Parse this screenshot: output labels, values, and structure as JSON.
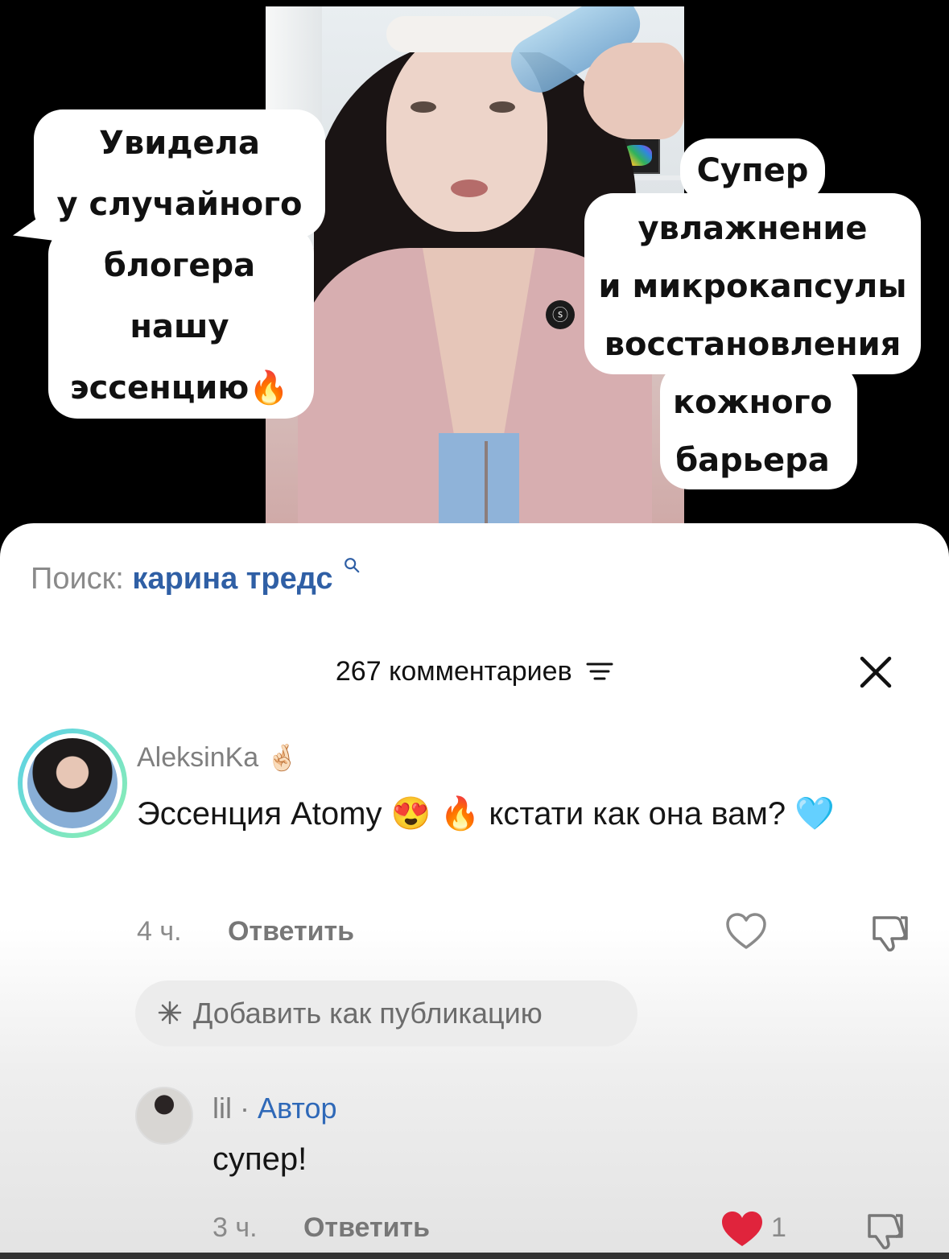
{
  "video": {
    "caption_left": [
      "Увидела",
      "у случайного",
      "блогера",
      "нашу",
      "эссенцию🔥"
    ],
    "caption_right": [
      "Супер",
      "увлажнение",
      "и микрокапсулы",
      "восстановления",
      "кожного",
      "барьера"
    ]
  },
  "search": {
    "prefix": "Поиск:",
    "term": "карина тредс"
  },
  "comments_header": {
    "count_label": "267 комментариев"
  },
  "comments": [
    {
      "username": "AleksinKa",
      "username_emoji": "🤞🏻",
      "text": "Эссенция Atomy 😍 🔥 кстати как она вам? 🩵",
      "time": "4 ч.",
      "reply_label": "Ответить",
      "liked": false
    }
  ],
  "add_publication_label": "Добавить как публикацию",
  "reply": {
    "username": "lil",
    "separator": "·",
    "author_badge": "Автор",
    "text": "супер!",
    "time": "3 ч.",
    "reply_label": "Ответить",
    "likes": "1",
    "liked": true
  },
  "colors": {
    "accent_blue": "#2f69b8",
    "like_red": "#e0243c",
    "avatar_ring": "#5ad0e8"
  }
}
